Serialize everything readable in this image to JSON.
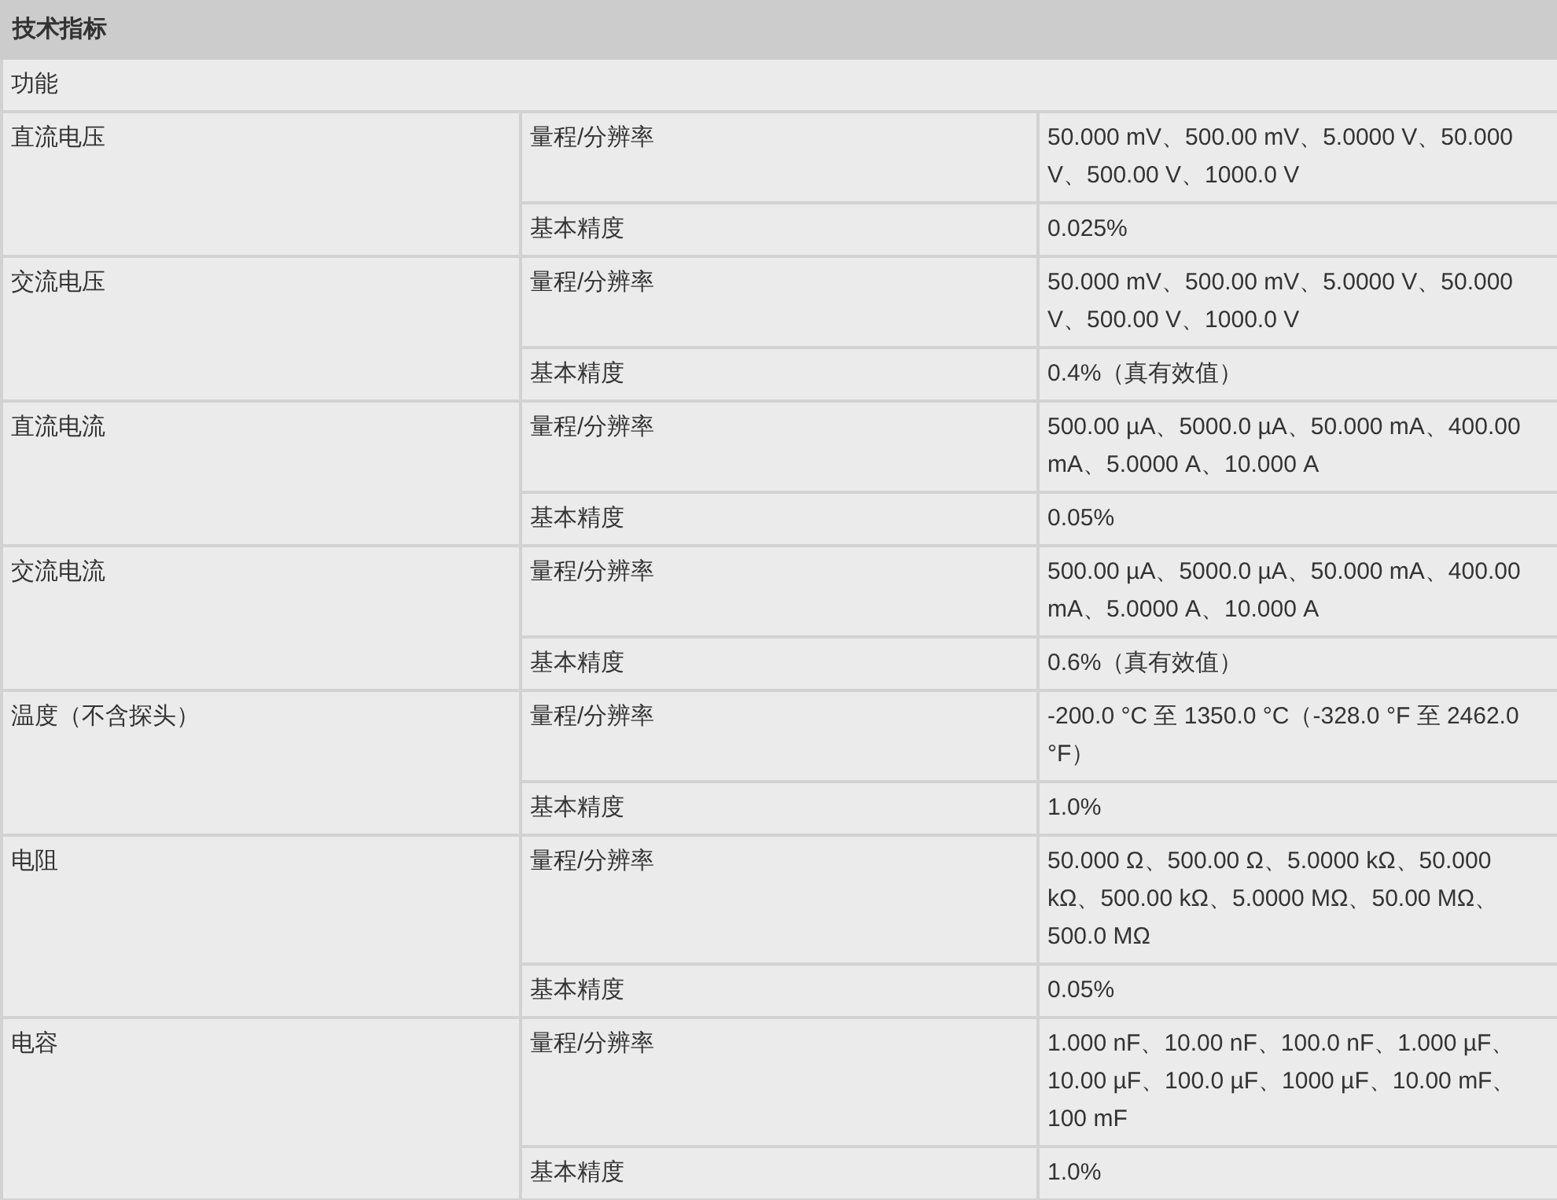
{
  "title": "技术指标",
  "section": "功能",
  "groups": [
    {
      "function": "直流电压",
      "rows": [
        {
          "label": "量程/分辨率",
          "value": "50.000 mV、500.00 mV、5.0000 V、50.000 V、500.00 V、1000.0 V"
        },
        {
          "label": "基本精度",
          "value": "0.025%"
        }
      ]
    },
    {
      "function": "交流电压",
      "rows": [
        {
          "label": "量程/分辨率",
          "value": "50.000 mV、500.00 mV、5.0000 V、50.000 V、500.00 V、1000.0 V"
        },
        {
          "label": "基本精度",
          "value": "0.4%（真有效值）"
        }
      ]
    },
    {
      "function": "直流电流",
      "rows": [
        {
          "label": "量程/分辨率",
          "value": "500.00 µA、5000.0 µA、50.000 mA、400.00 mA、5.0000 A、10.000 A"
        },
        {
          "label": "基本精度",
          "value": "0.05%"
        }
      ]
    },
    {
      "function": "交流电流",
      "rows": [
        {
          "label": "量程/分辨率",
          "value": "500.00 µA、5000.0 µA、50.000 mA、400.00 mA、5.0000 A、10.000 A"
        },
        {
          "label": "基本精度",
          "value": "0.6%（真有效值）"
        }
      ]
    },
    {
      "function": "温度（不含探头）",
      "rows": [
        {
          "label": "量程/分辨率",
          "value": "-200.0 °C 至 1350.0 °C（-328.0 °F 至 2462.0 °F）"
        },
        {
          "label": "基本精度",
          "value": "1.0%"
        }
      ]
    },
    {
      "function": "电阻",
      "rows": [
        {
          "label": "量程/分辨率",
          "value": "50.000 Ω、500.00 Ω、5.0000 kΩ、50.000 kΩ、500.00 kΩ、5.0000 MΩ、50.00 MΩ、500.0 MΩ"
        },
        {
          "label": "基本精度",
          "value": "0.05%"
        }
      ]
    },
    {
      "function": "电容",
      "rows": [
        {
          "label": "量程/分辨率",
          "value": "1.000 nF、10.00 nF、100.0 nF、1.000 µF、10.00 µF、100.0 µF、1000 µF、10.00 mF、100 mF"
        },
        {
          "label": "基本精度",
          "value": "1.0%"
        }
      ]
    }
  ]
}
